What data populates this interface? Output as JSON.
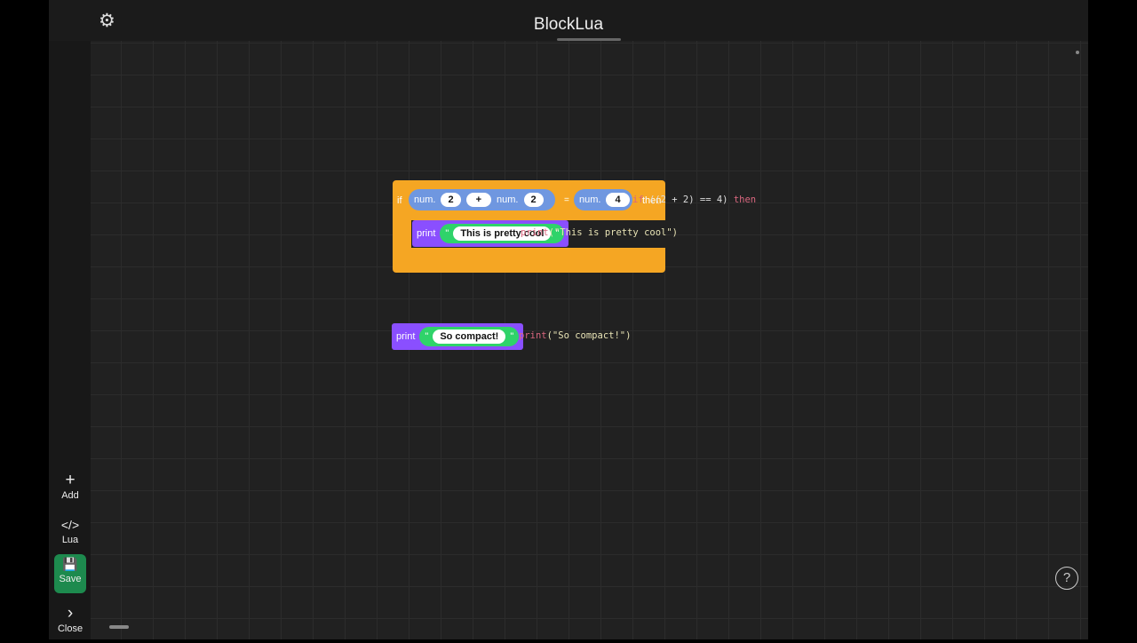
{
  "header": {
    "title": "BlockLua",
    "settings_icon": "gear-icon"
  },
  "sidebar": {
    "items": [
      {
        "label": "Add",
        "icon": "+"
      },
      {
        "label": "Lua",
        "icon": "</>"
      },
      {
        "label": "Save",
        "icon": "💾"
      },
      {
        "label": "Close",
        "icon": "›"
      }
    ]
  },
  "blocks": {
    "if_block": {
      "if_label": "if",
      "num_label": "num.",
      "a": "2",
      "op": "+",
      "b": "2",
      "eq": "=",
      "c": "4",
      "then_label": "then",
      "code_if": "if",
      "code_expr": " ((2 + 2) == 4) ",
      "code_then": "then",
      "print": {
        "label": "print",
        "quote": "\"",
        "text": "This is pretty cool",
        "code_fn": "print",
        "code_args": "(\"This is pretty cool\")"
      }
    },
    "print_block": {
      "label": "print",
      "quote": "\"",
      "text": "So compact!",
      "code_fn": "print",
      "code_args": "(\"So compact!\")"
    }
  },
  "help": "?",
  "colors": {
    "if": "#f5a623",
    "num": "#6f97e0",
    "print": "#8a4fff",
    "string": "#2fd36a",
    "save": "#1d8a4e"
  }
}
